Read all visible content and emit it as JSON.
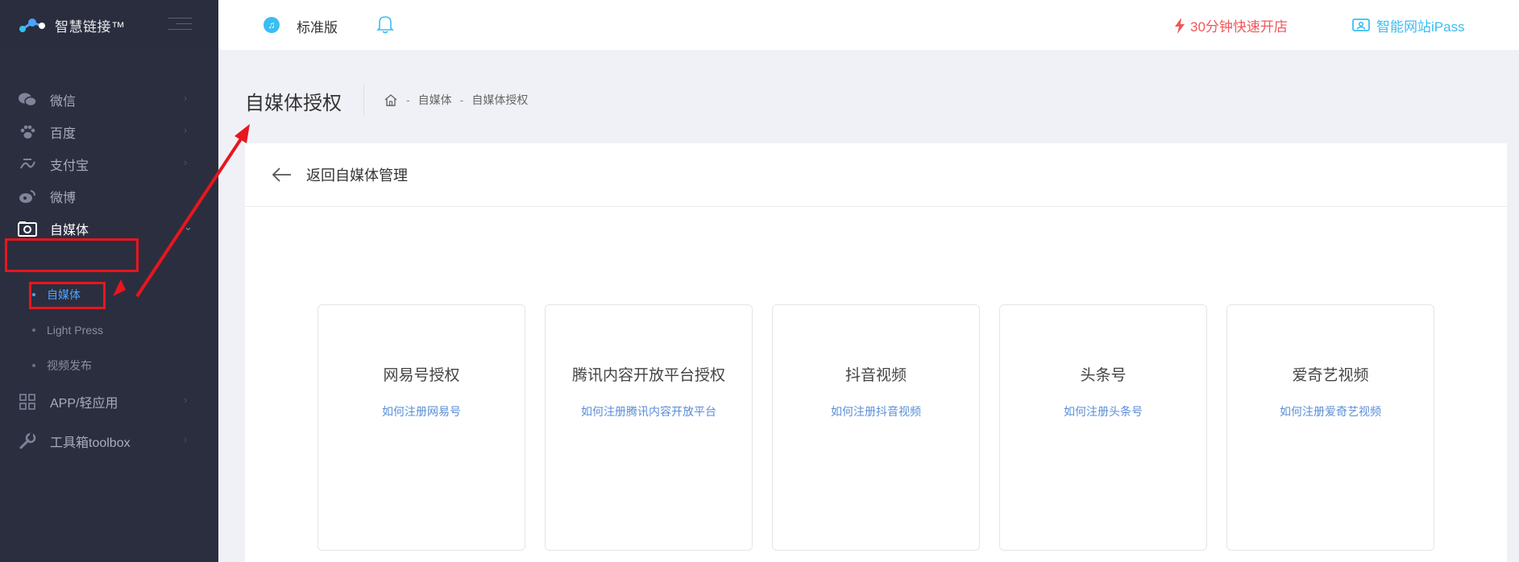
{
  "app": {
    "name": "智慧链接™"
  },
  "sidebar": {
    "items": [
      {
        "label": "微信",
        "icon": "wechat-icon"
      },
      {
        "label": "百度",
        "icon": "paw-icon"
      },
      {
        "label": "支付宝",
        "icon": "alipay-icon"
      },
      {
        "label": "微博",
        "icon": "weibo-icon"
      },
      {
        "label": "自媒体",
        "icon": "camera-icon"
      },
      {
        "label": "APP/轻应用",
        "icon": "grid-icon"
      },
      {
        "label": "工具箱toolbox",
        "icon": "wrench-icon"
      }
    ],
    "submenu": [
      {
        "label": "自媒体"
      },
      {
        "label": "Light Press"
      },
      {
        "label": "视频发布"
      }
    ]
  },
  "header": {
    "edition": "标准版",
    "promo": "30分钟快速开店",
    "ipass": "智能网站iPass"
  },
  "page": {
    "title": "自媒体授权",
    "breadcrumb": [
      "自媒体",
      "自媒体授权"
    ],
    "back_label": "返回自媒体管理"
  },
  "cards": [
    {
      "title": "网易号授权",
      "link": "如何注册网易号"
    },
    {
      "title": "腾讯内容开放平台授权",
      "link": "如何注册腾讯内容开放平台"
    },
    {
      "title": "抖音视频",
      "link": "如何注册抖音视频"
    },
    {
      "title": "头条号",
      "link": "如何注册头条号"
    },
    {
      "title": "爱奇艺视频",
      "link": "如何注册爱奇艺视频"
    }
  ],
  "colors": {
    "sidebar_bg": "#2b2e3f",
    "accent_blue": "#3bbdf2",
    "promo_red": "#f0575b",
    "link_blue": "#5a8ed6",
    "annotation_red": "#e8161d"
  }
}
